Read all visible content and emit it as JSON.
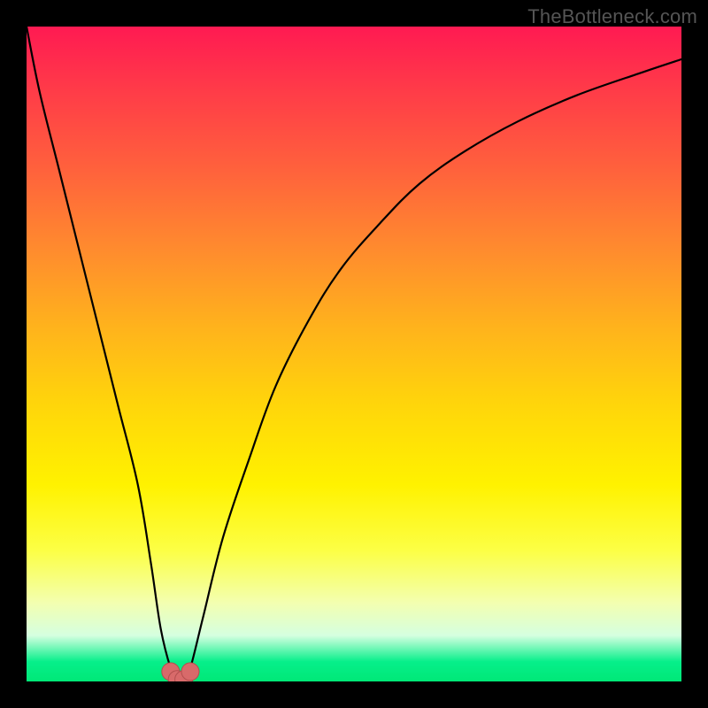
{
  "watermark": "TheBottleneck.com",
  "colors": {
    "frame_bg": "#000000",
    "curve_stroke": "#000000",
    "marker_fill": "#d86a6a",
    "marker_stroke": "#b34e4e"
  },
  "chart_data": {
    "type": "line",
    "title": "",
    "xlabel": "",
    "ylabel": "",
    "xlim": [
      0,
      100
    ],
    "ylim": [
      0,
      100
    ],
    "grid": false,
    "legend": false,
    "annotations": [],
    "series": [
      {
        "name": "bottleneck-curve",
        "x": [
          0,
          2,
          5,
          8,
          11,
          14,
          17,
          19,
          20.5,
          22,
          23,
          24,
          25,
          27,
          30,
          34,
          38,
          43,
          48,
          54,
          60,
          67,
          75,
          84,
          94,
          100
        ],
        "y": [
          100,
          90,
          78,
          66,
          54,
          42,
          30,
          18,
          8,
          2,
          0,
          0,
          2,
          10,
          22,
          34,
          45,
          55,
          63,
          70,
          76,
          81,
          85.5,
          89.5,
          93,
          95
        ]
      }
    ],
    "markers": [
      {
        "x": 22.0,
        "y": 1.5
      },
      {
        "x": 23.0,
        "y": 0.3
      },
      {
        "x": 24.0,
        "y": 0.3
      },
      {
        "x": 25.0,
        "y": 1.5
      }
    ]
  }
}
